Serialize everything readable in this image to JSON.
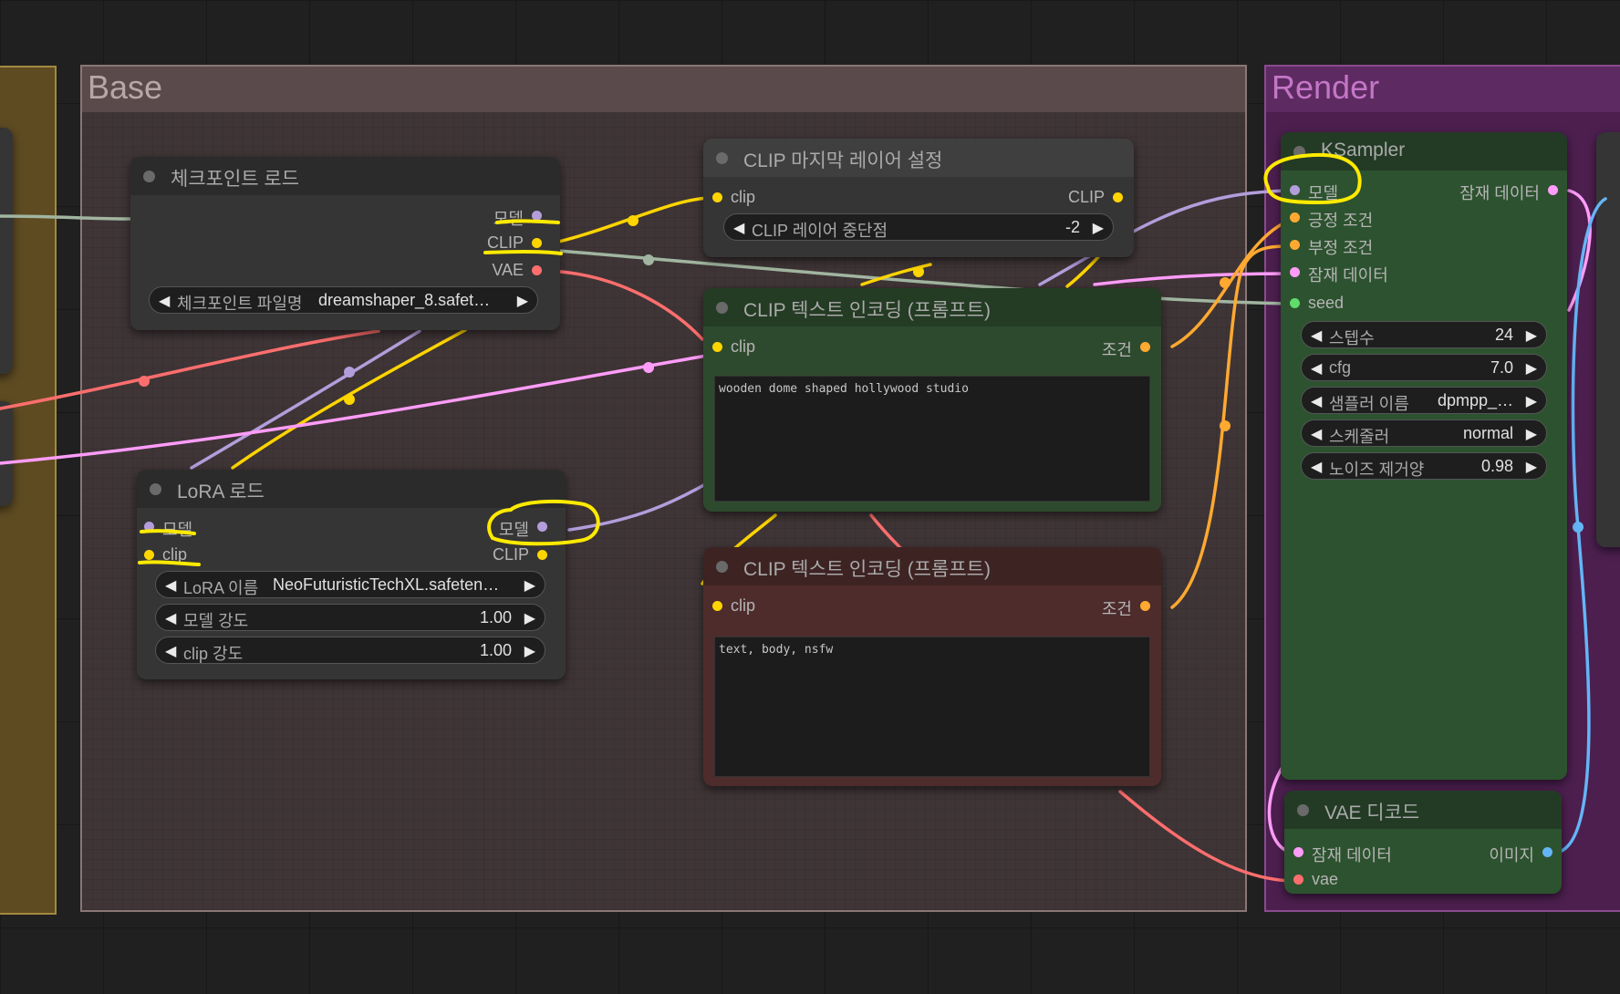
{
  "colors": {
    "canvas_bg": "#202020",
    "group_base": "#3f3536",
    "group_render": "#4c1f4f",
    "group_left": "#5e4b22",
    "node_bg": "#353535",
    "node_title": "#2a2a2a",
    "green_node": "#2e4a2e",
    "red_node": "#4e2c2c",
    "ksampler_bg": "#2d522f",
    "wire_model": "#b39ddb",
    "wire_clip": "#ffd500",
    "wire_vae": "#ff6e6e",
    "wire_latent": "#ff9cf9",
    "wire_cond": "#ffa931",
    "wire_seed": "#a1b5a0",
    "wire_image": "#64b5f6",
    "annotation": "#ffea00"
  },
  "groups": {
    "base": {
      "title": "Base"
    },
    "render": {
      "title": "Render"
    }
  },
  "nodes": {
    "checkpoint": {
      "title": "체크포인트 로드",
      "out_model": "모델",
      "out_clip": "CLIP",
      "out_vae": "VAE",
      "ckpt_label": "체크포인트 파일명",
      "ckpt_value": "dreamshaper_8.safet…"
    },
    "lora": {
      "title": "LoRA 로드",
      "in_model": "모델",
      "in_clip": "clip",
      "out_model": "모델",
      "out_clip": "CLIP",
      "lora_name_label": "LoRA 이름",
      "lora_name_value": "NeoFuturisticTechXL.safeten…",
      "model_strength_label": "모델 강도",
      "model_strength_value": "1.00",
      "clip_strength_label": "clip 강도",
      "clip_strength_value": "1.00"
    },
    "clip_last_layer": {
      "title": "CLIP 마지막 레이어 설정",
      "in_clip": "clip",
      "out_clip": "CLIP",
      "stop_label": "CLIP 레이어 중단점",
      "stop_value": "-2"
    },
    "clip_pos": {
      "title": "CLIP 텍스트 인코딩 (프롬프트)",
      "in_clip": "clip",
      "out_cond": "조건",
      "text": "wooden dome shaped hollywood studio"
    },
    "clip_neg": {
      "title": "CLIP 텍스트 인코딩 (프롬프트)",
      "in_clip": "clip",
      "out_cond": "조건",
      "text": "text, body, nsfw"
    },
    "ksampler": {
      "title": "KSampler",
      "in_model": "모델",
      "in_positive": "긍정 조건",
      "in_negative": "부정 조건",
      "in_latent": "잠재 데이터",
      "in_seed": "seed",
      "out_latent": "잠재 데이터",
      "steps_label": "스텝수",
      "steps_value": "24",
      "cfg_label": "cfg",
      "cfg_value": "7.0",
      "sampler_label": "샘플러 이름",
      "sampler_value": "dpmpp_…",
      "scheduler_label": "스케줄러",
      "scheduler_value": "normal",
      "denoise_label": "노이즈 제거양",
      "denoise_value": "0.98"
    },
    "vae_decode": {
      "title": "VAE 디코드",
      "in_latent": "잠재 데이터",
      "in_vae": "vae",
      "out_image": "이미지"
    }
  }
}
